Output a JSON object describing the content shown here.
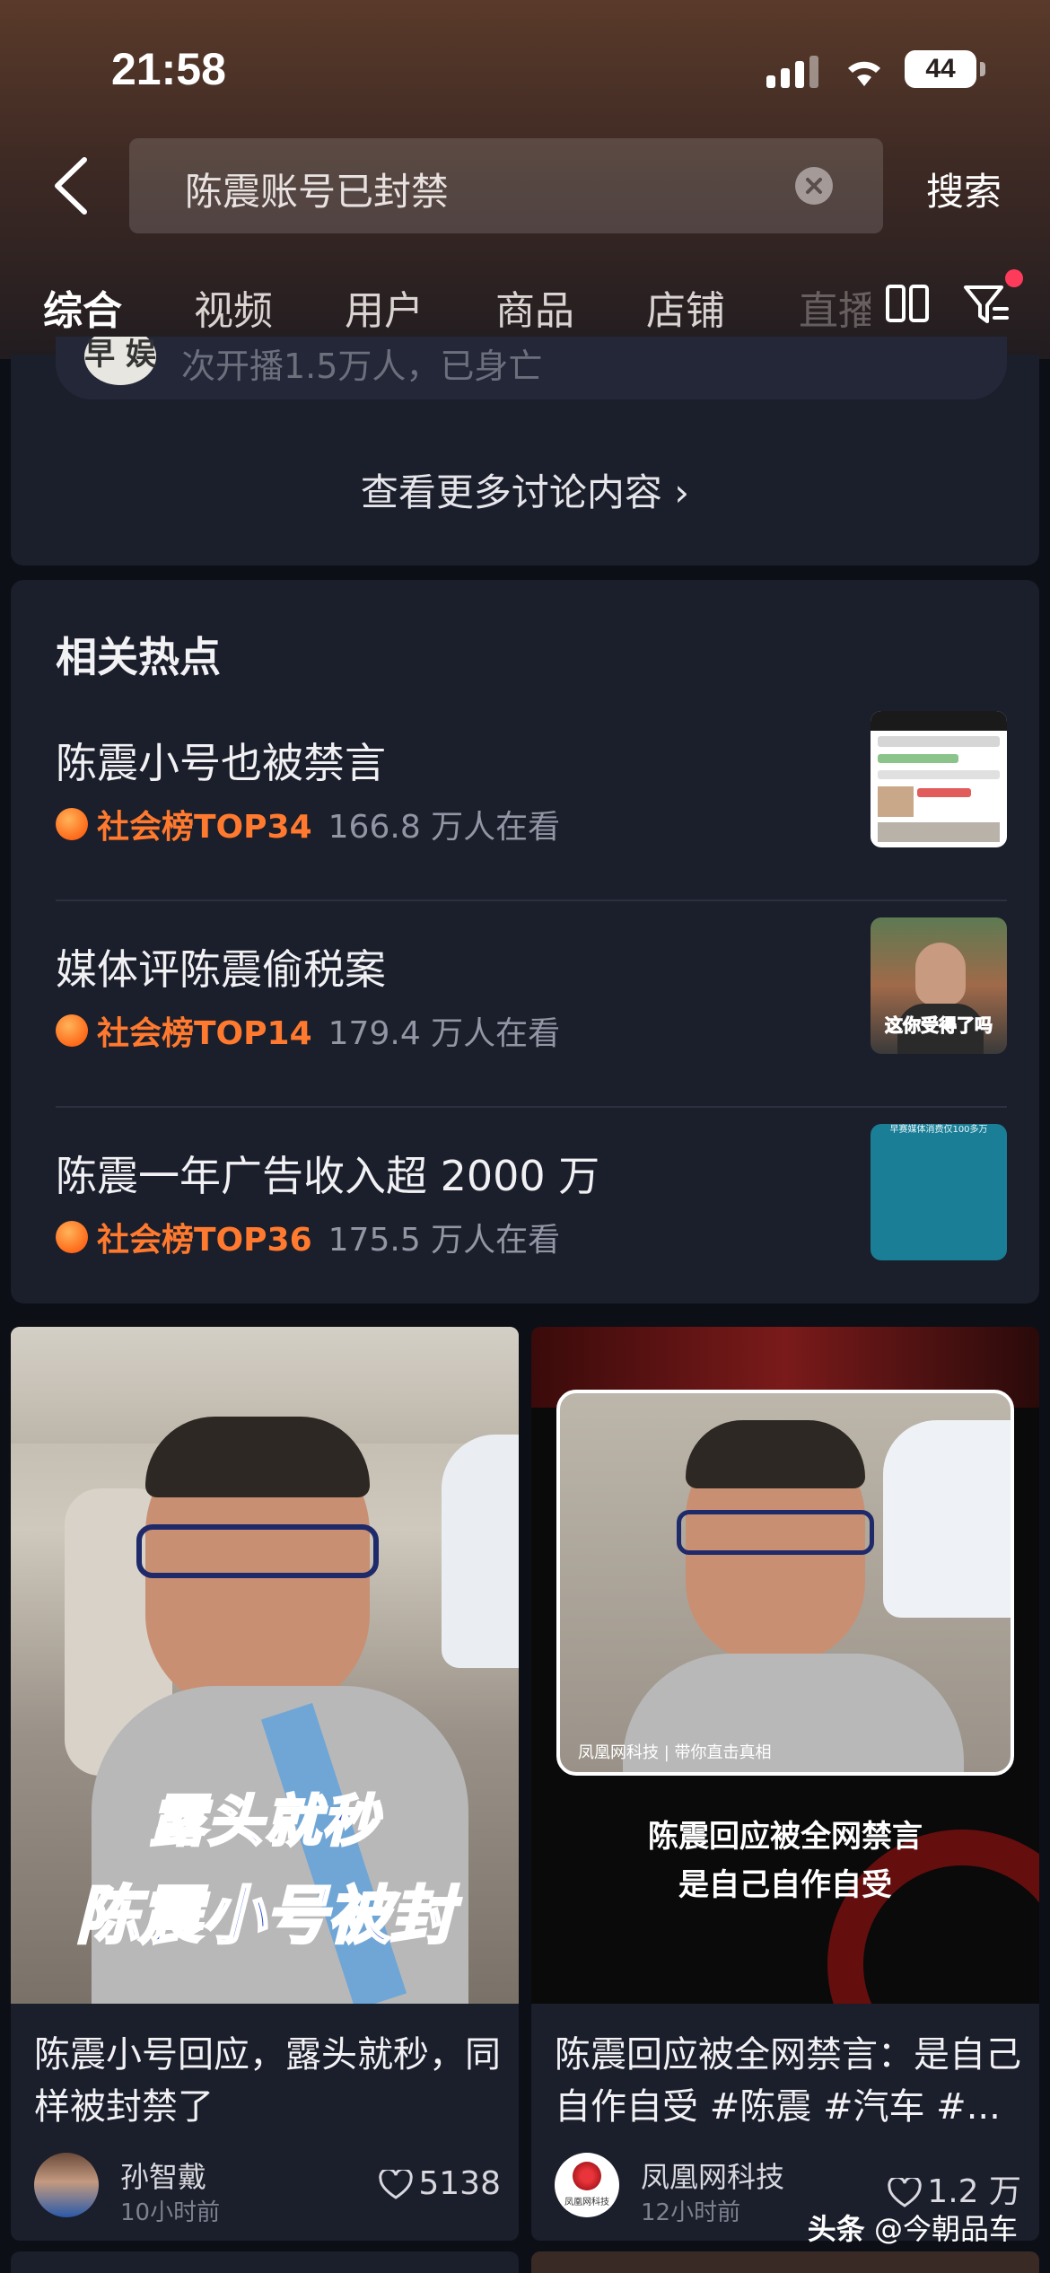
{
  "status_bar": {
    "time": "21:58",
    "battery": "44"
  },
  "search": {
    "query": "陈震账号已封禁",
    "button_label": "搜索"
  },
  "tabs": [
    {
      "label": "综合",
      "active": true
    },
    {
      "label": "视频"
    },
    {
      "label": "用户"
    },
    {
      "label": "商品"
    },
    {
      "label": "店铺"
    },
    {
      "label": "直播"
    }
  ],
  "discussion": {
    "prev_avatar_text": "早 娱",
    "prev_text": "次开播1.5万人，已身亡",
    "more_link": "查看更多讨论内容 ›"
  },
  "hot": {
    "title": "相关热点",
    "items": [
      {
        "name": "陈震小号也被禁言",
        "rank": "社会榜TOP34",
        "viewers": "166.8 万人在看"
      },
      {
        "name": "媒体评陈震偷税案",
        "rank": "社会榜TOP14",
        "viewers": "179.4 万人在看",
        "thumb_caption": "这你受得了吗"
      },
      {
        "name": "陈震一年广告收入超 2000 万",
        "rank": "社会榜TOP36",
        "viewers": "175.5 万人在看",
        "thumb_caption": "早赛媒体消费仅100多万"
      }
    ]
  },
  "feed": [
    {
      "overlay_top": "露头就秒",
      "overlay_bottom": "陈震小号被封",
      "title": "陈震小号回应，露头就秒，同样被封禁了",
      "author": "孙智戴",
      "time": "10小时前",
      "likes": "5138"
    },
    {
      "overlay_caption_small": "凤凰网科技 | 带你直击真相",
      "overlay_line1": "陈震回应被全网禁言",
      "overlay_line2": "是自己自作自受",
      "title": "陈震回应被全网禁言：是自己自作自受 #陈震 #汽车 #...",
      "author": "凤凰网科技",
      "avatar_text": "凤凰网科技",
      "time": "12小时前",
      "likes": "1.2 万"
    }
  ],
  "watermark": {
    "brand": "头条",
    "handle": "@今朝品车"
  }
}
